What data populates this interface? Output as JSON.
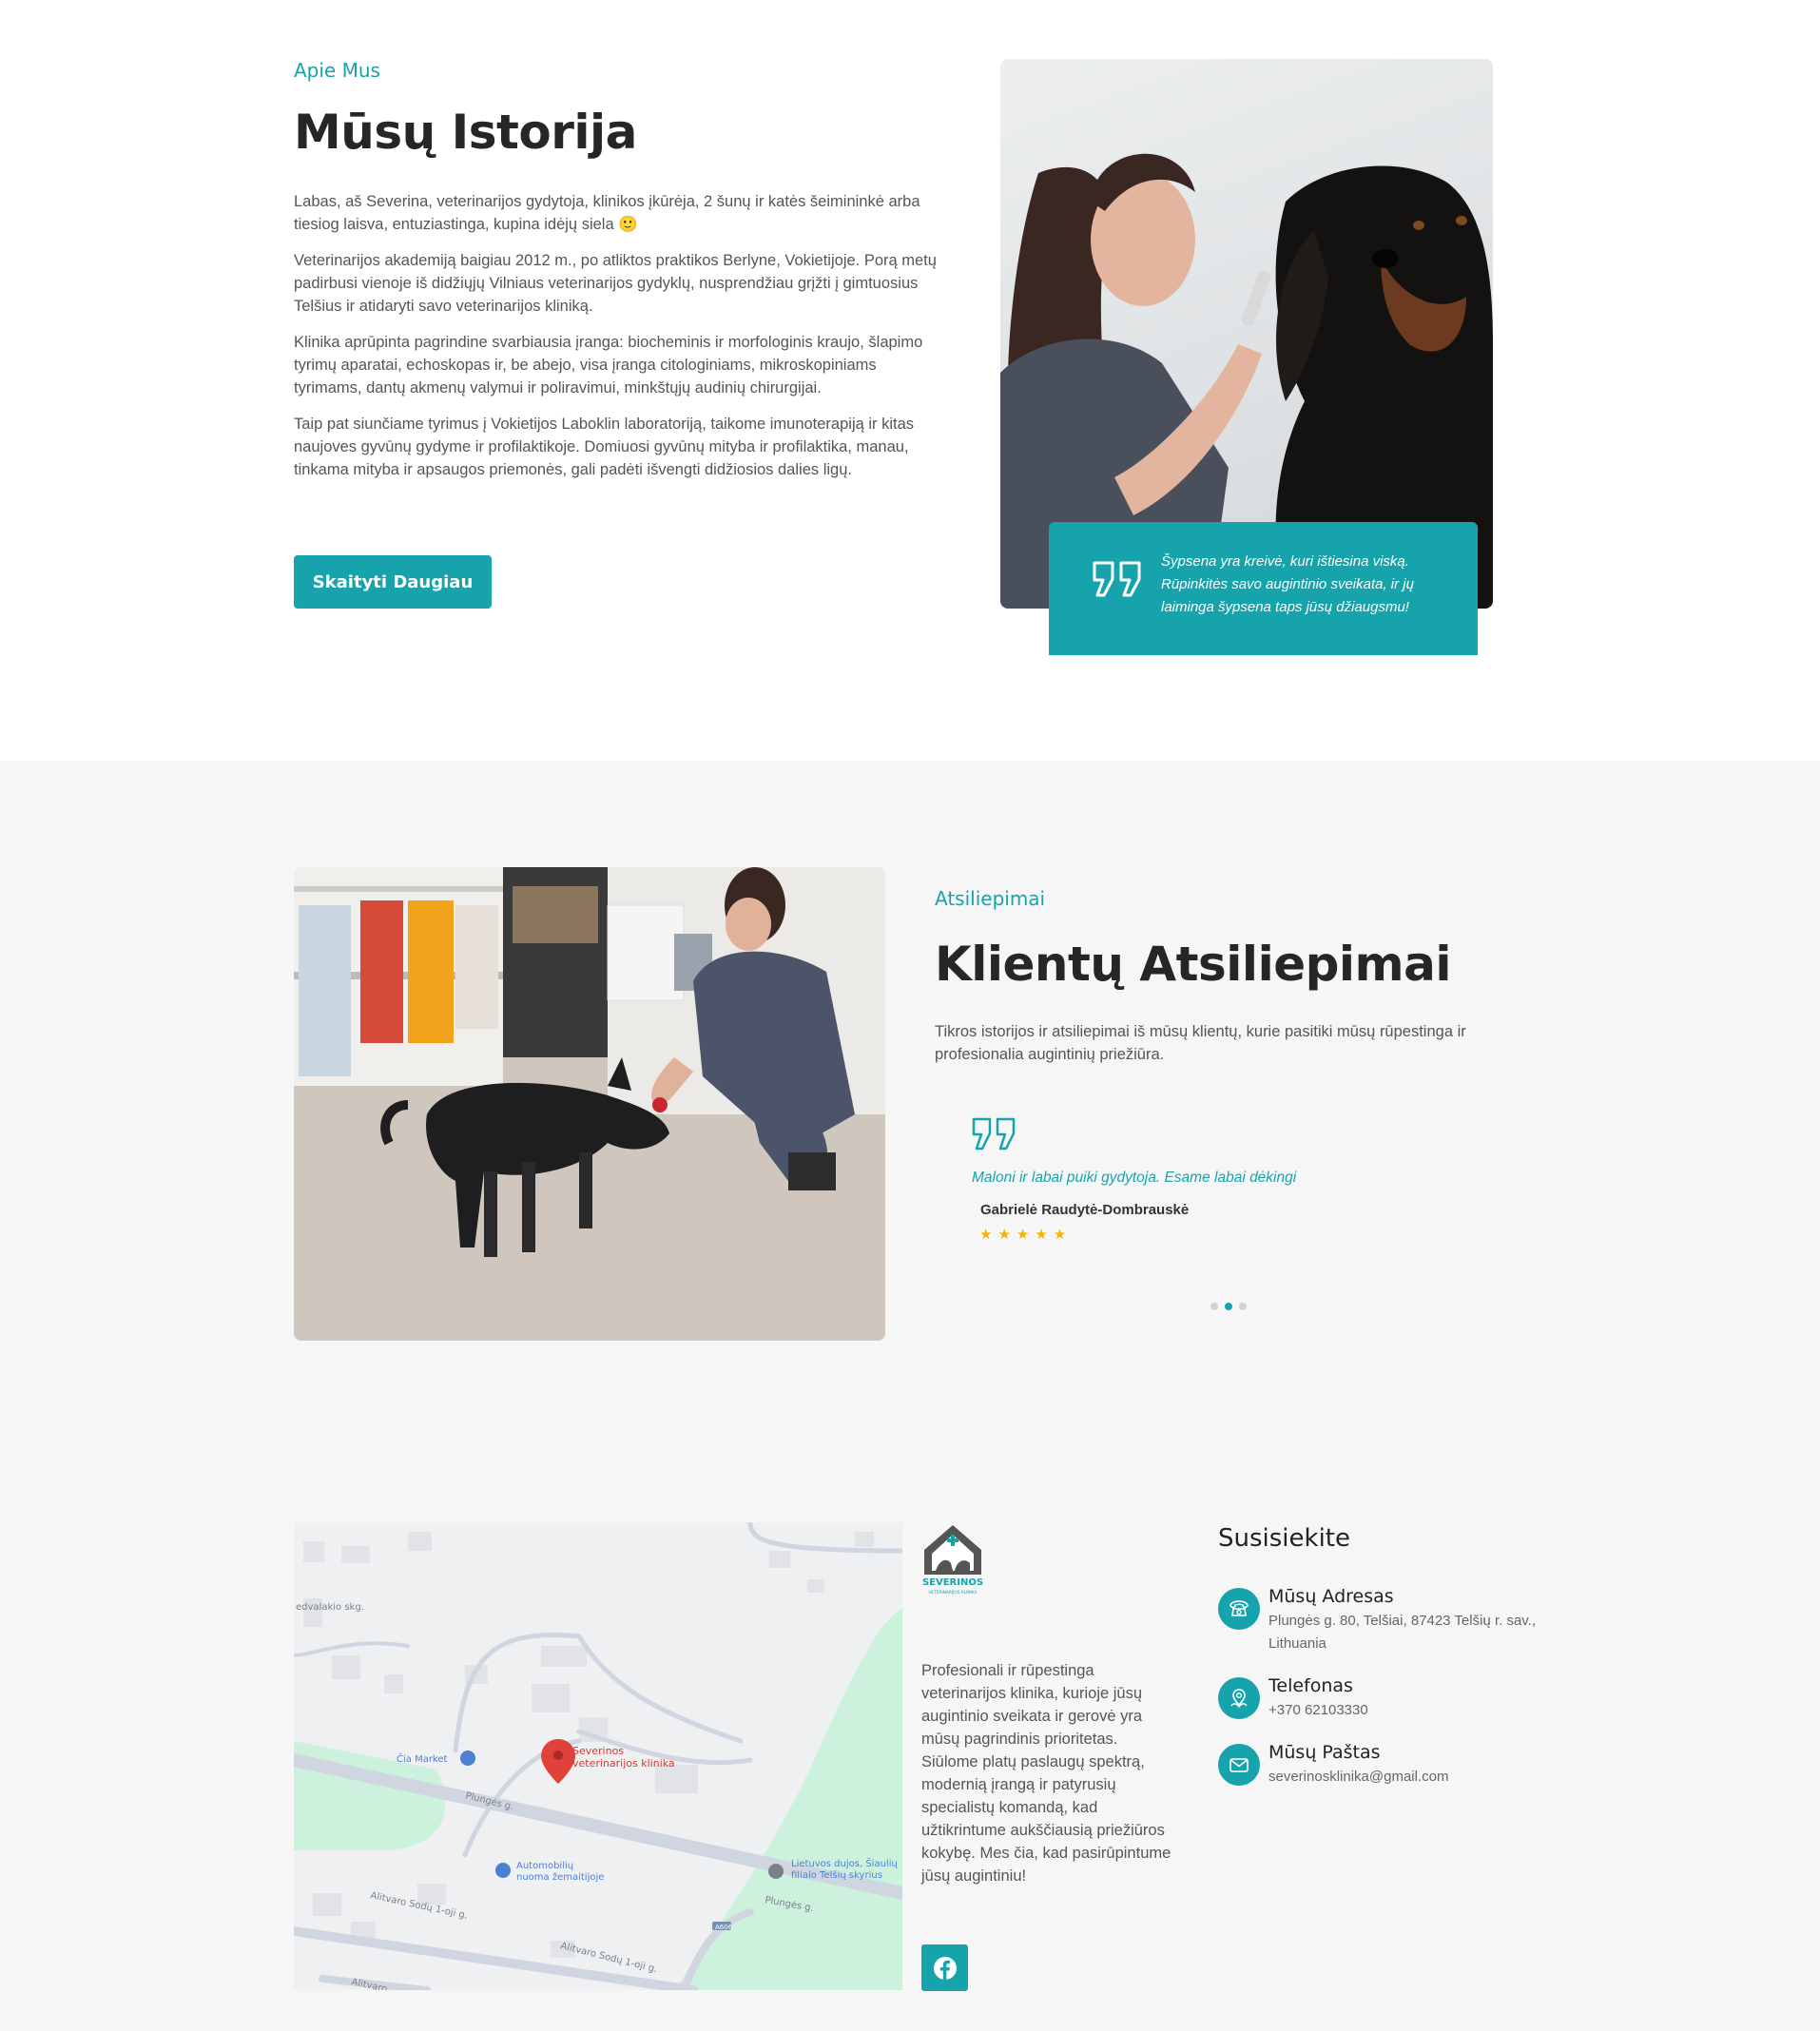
{
  "about": {
    "eyebrow": "Apie Mus",
    "title": "Mūsų Istorija",
    "paragraphs": [
      "Labas, aš Severina, veterinarijos gydytoja, klinikos įkūrėja, 2 šunų ir katės šeimininkė arba tiesiog laisva, entuziastinga, kupina idėjų siela 🙂",
      "Veterinarijos akademiją baigiau 2012 m., po atliktos praktikos Berlyne, Vokietijoje. Porą metų padirbusi vienoje iš didžiųjų Vilniaus veterinarijos gydyklų, nusprendžiau grįžti į gimtuosius Telšius ir atidaryti savo veterinarijos kliniką.",
      "Klinika aprūpinta pagrindine svarbiausia įranga: biocheminis ir morfologinis kraujo, šlapimo tyrimų aparatai, echoskopas ir, be abejo, visa įranga citologiniams, mikroskopiniams tyrimams, dantų akmenų valymui ir poliravimui, minkštųjų audinių chirurgijai.",
      "Taip pat siunčiame tyrimus į Vokietijos Laboklin laboratoriją, taikome imunoterapiją ir kitas naujoves gyvūnų gydyme ir profilaktikoje. Domiuosi gyvūnų mityba ir profilaktika, manau, tinkama mityba ir apsaugos priemonės, gali padėti išvengti didžiosios dalies ligų."
    ],
    "button_label": "Skaityti Daugiau",
    "quote": "Šypsena yra kreivė, kuri ištiesina viską. Rūpinkitės savo augintinio sveikata, ir jų laiminga šypsena taps jūsų džiaugsmu!"
  },
  "testimonials": {
    "eyebrow": "Atsiliepimai",
    "title": "Klientų Atsiliepimai",
    "intro": "Tikros istorijos ir atsiliepimai iš mūsų klientų, kurie pasitiki mūsų rūpestinga ir profesionalia augintinių priežiūra.",
    "active_slide": {
      "quote": "Maloni ir labai puiki gydytoja. Esame labai dėkingi",
      "author": "Gabrielė Raudytė-Dombrauskė",
      "rating": 5,
      "stars": "★★★★★"
    },
    "dots": 3,
    "active_dot": 2
  },
  "map": {
    "pin_label_1": "Severinos",
    "pin_label_2": "veterinarijos klinika",
    "market": "Čia Market",
    "street_1": "Plungės g.",
    "street_2": "Plungės g.",
    "street_3": "Alitvaro Sodų 1-oji g.",
    "street_4": "Alitvaro Sodų 1-oji g.",
    "street_5": "Alitvaro",
    "street_6": "edvalakio skg.",
    "car_rent_1": "Automobilių",
    "car_rent_2": "nuoma žemaitijoje",
    "post_1": "Lietuvos dujos, Šiaulių",
    "post_2": "filialo Telšių skyrius",
    "road_badge": "A606"
  },
  "footer": {
    "logo_name": "SEVERINOS",
    "logo_sub": "VETERINARIJOS KLINIKA",
    "description": "Profesionali ir rūpestinga veterinarijos klinika, kurioje jūsų augintinio sveikata ir gerovė yra mūsų pagrindinis prioritetas. Siūlome platų paslaugų spektrą, modernią įrangą ir patyrusių specialistų komandą, kad užtikrintume aukščiausią priežiūros kokybę. Mes čia, kad pasirūpintume jūsų augintiniu!",
    "contact_title": "Susisiekite",
    "contacts": [
      {
        "label": "Mūsų Adresas",
        "value": "Plungės g. 80, Telšiai, 87423 Telšių r. sav., Lithuania",
        "icon": "phone-icon"
      },
      {
        "label": "Telefonas",
        "value": "+370 62103330",
        "icon": "location-person-icon"
      },
      {
        "label": "Mūsų Paštas",
        "value": "severinosklinika@gmail.com",
        "icon": "mail-icon"
      }
    ]
  },
  "colors": {
    "accent": "#17a3ab",
    "section_bg": "#f6f6f6",
    "heading": "#262626",
    "star": "#f5b301"
  }
}
